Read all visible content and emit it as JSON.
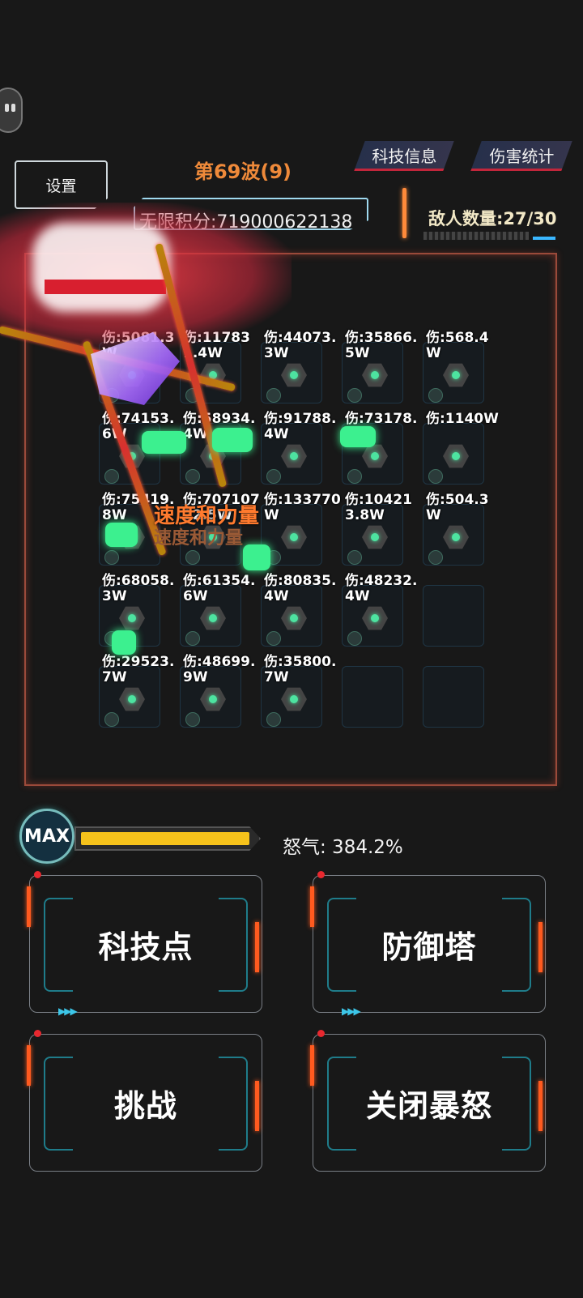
{
  "header": {
    "settings_label": "设置",
    "wave_title": "第69波(9)",
    "score_text": "无限积分:719000622138",
    "tech_info_tab": "科技信息",
    "damage_stats_tab": "伤害统计",
    "enemy_count_text": "敌人数量:27/30"
  },
  "board": {
    "cells": [
      {
        "damage": "伤:5081.3W"
      },
      {
        "damage": "伤:117831.4W"
      },
      {
        "damage": "伤:44073.3W"
      },
      {
        "damage": "伤:35866.5W"
      },
      {
        "damage": "伤:568.4W"
      },
      {
        "damage": "伤:74153.6W"
      },
      {
        "damage": "伤:58934.4W"
      },
      {
        "damage": "伤:91788.4W"
      },
      {
        "damage": "伤:73178.6W"
      },
      {
        "damage": "伤:1140W"
      },
      {
        "damage": "伤:75419.8W"
      },
      {
        "damage": "伤:70710722.5W"
      },
      {
        "damage": "伤:133770W"
      },
      {
        "damage": "伤:104213.8W"
      },
      {
        "damage": "伤:504.3W"
      },
      {
        "damage": "伤:68058.3W"
      },
      {
        "damage": "伤:61354.6W"
      },
      {
        "damage": "伤:80835.4W"
      },
      {
        "damage": "伤:48232.4W"
      },
      {
        "damage": ""
      },
      {
        "damage": "伤:29523.7W"
      },
      {
        "damage": "伤:48699.9W"
      },
      {
        "damage": "伤:35800.7W"
      },
      {
        "damage": ""
      },
      {
        "damage": ""
      }
    ],
    "floating_label": "速度和力量",
    "floating_label_echo": "速度和力量"
  },
  "rage": {
    "max_label": "MAX",
    "level": 1.0,
    "text": "怒气: 384.2%"
  },
  "actions": {
    "tech_points": "科技点",
    "defense_tower": "防御塔",
    "challenge": "挑战",
    "close_rage": "关闭暴怒"
  },
  "colors": {
    "accent_orange": "#ef8a3a",
    "rage_yellow": "#f6c21b",
    "tower_green": "#3cf08f",
    "panel_cyan": "#1f7c8a"
  }
}
